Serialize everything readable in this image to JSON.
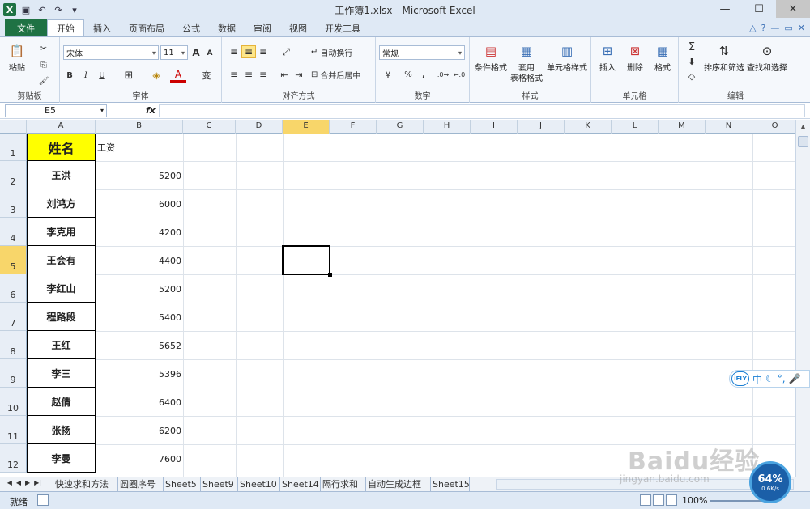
{
  "window": {
    "title": "工作簿1.xlsx - Microsoft Excel",
    "controls": [
      "—",
      "☐",
      "✕"
    ]
  },
  "quick_access": {
    "save_glyph": "▣",
    "undo_glyph": "↶",
    "redo_glyph": "↷",
    "customize_glyph": "▾"
  },
  "tabs": {
    "file": "文件",
    "items": [
      "开始",
      "插入",
      "页面布局",
      "公式",
      "数据",
      "审阅",
      "视图",
      "开发工具"
    ],
    "active": "开始"
  },
  "ribbon": {
    "clipboard": {
      "label": "剪贴板",
      "paste": "粘贴"
    },
    "font": {
      "label": "字体",
      "name": "宋体",
      "size": "11",
      "bold": "B",
      "italic": "I",
      "underline": "U",
      "grow": "A",
      "shrink": "A",
      "color_glyph": "A",
      "phonetic": "变"
    },
    "alignment": {
      "label": "对齐方式",
      "wrap": "自动换行",
      "merge": "合并后居中"
    },
    "number": {
      "label": "数字",
      "format": "常规",
      "percent": "%",
      "comma": ","
    },
    "styles": {
      "label": "样式",
      "conditional": "条件格式",
      "table1": "套用",
      "table2": "表格格式",
      "cell_styles": "单元格样式"
    },
    "cells": {
      "label": "单元格",
      "insert": "插入",
      "delete": "删除",
      "format": "格式"
    },
    "editing": {
      "label": "编辑",
      "sort": "排序和筛选",
      "find": "查找和选择",
      "sum": "Σ"
    }
  },
  "formula_bar": {
    "name_box": "E5",
    "fx": "fx",
    "value": ""
  },
  "columns": [
    "A",
    "B",
    "C",
    "D",
    "E",
    "F",
    "G",
    "H",
    "I",
    "J",
    "K",
    "L",
    "M",
    "N",
    "O"
  ],
  "selected_column": "E",
  "rows": [
    {
      "num": "1",
      "name": "姓名",
      "salary": "工资"
    },
    {
      "num": "2",
      "name": "王洪",
      "salary": "5200"
    },
    {
      "num": "3",
      "name": "刘鸿方",
      "salary": "6000"
    },
    {
      "num": "4",
      "name": "李克用",
      "salary": "4200"
    },
    {
      "num": "5",
      "name": "王会有",
      "salary": "4400"
    },
    {
      "num": "6",
      "name": "李红山",
      "salary": "5200"
    },
    {
      "num": "7",
      "name": "程路段",
      "salary": "5400"
    },
    {
      "num": "8",
      "name": "王红",
      "salary": "5652"
    },
    {
      "num": "9",
      "name": "李三",
      "salary": "5396"
    },
    {
      "num": "10",
      "name": "赵倩",
      "salary": "6400"
    },
    {
      "num": "11",
      "name": "张扬",
      "salary": "6200"
    },
    {
      "num": "12",
      "name": "李曼",
      "salary": "7600"
    }
  ],
  "selected_row": "5",
  "sheets": [
    "快速求和方法",
    "圆圈序号",
    "Sheet5",
    "Sheet9",
    "Sheet10",
    "Sheet14",
    "隔行求和",
    "自动生成边框",
    "Sheet15"
  ],
  "status": {
    "ready": "就绪",
    "zoom": "100%"
  },
  "overlays": {
    "ifly_logo": "iFLY",
    "ifly_glyphs": [
      "中",
      "☾",
      "°,",
      "🎤"
    ],
    "speed_percent": "64%",
    "speed_rate": "0.6K/s",
    "watermark": "Baidu经验",
    "watermark_url": "jingyan.baidu.com"
  },
  "colors": {
    "accent": "#1f7244",
    "header_fill": "#ffff00",
    "selection": "#f8d66a"
  }
}
